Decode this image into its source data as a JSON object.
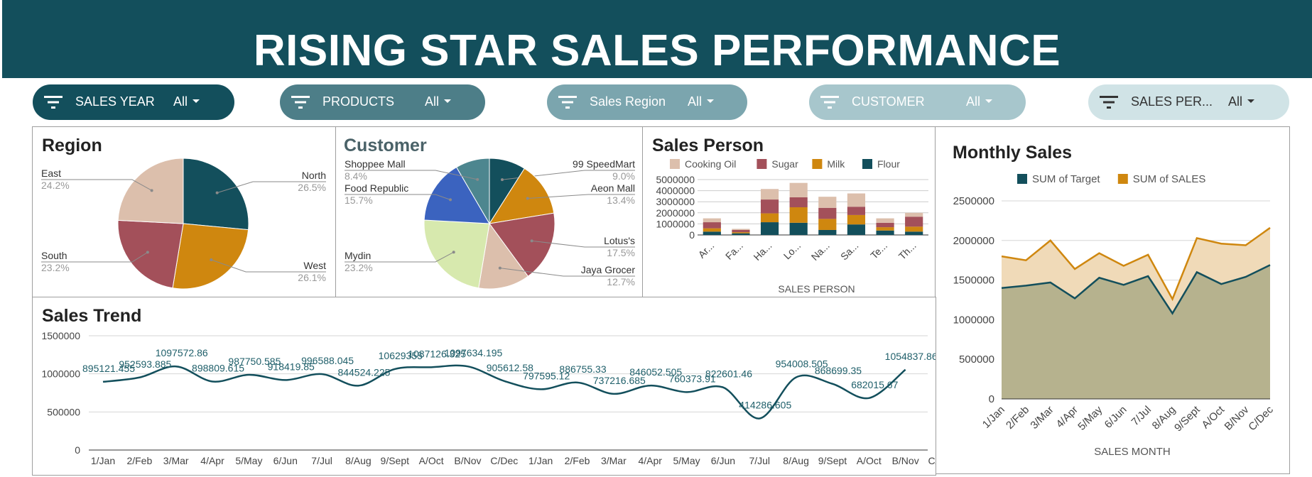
{
  "header": {
    "title": "RISING STAR SALES PERFORMANCE"
  },
  "filters": [
    {
      "label": "SALES YEAR",
      "value": "All",
      "bg": "#134f5c",
      "fg": "#ffffff"
    },
    {
      "label": "PRODUCTS",
      "value": "All",
      "bg": "#4d7e88",
      "fg": "#ffffff"
    },
    {
      "label": "Sales Region",
      "value": "All",
      "bg": "#7ba5ae",
      "fg": "#ffffff"
    },
    {
      "label": "CUSTOMER",
      "value": "All",
      "bg": "#a7c6cc",
      "fg": "#ffffff"
    },
    {
      "label": "SALES PER...",
      "value": "All",
      "bg": "#d0e3e6",
      "fg": "#333333"
    }
  ],
  "chart_data": [
    {
      "type": "pie",
      "title": "Region",
      "slices": [
        {
          "label": "North",
          "value": 26.5,
          "pct": "26.5%",
          "color": "#134f5c"
        },
        {
          "label": "West",
          "value": 26.1,
          "pct": "26.1%",
          "color": "#cf870f"
        },
        {
          "label": "South",
          "value": 23.2,
          "pct": "23.2%",
          "color": "#a3505a"
        },
        {
          "label": "East",
          "value": 24.2,
          "pct": "24.2%",
          "color": "#dcbfac"
        }
      ]
    },
    {
      "type": "pie",
      "title": "Customer",
      "slices": [
        {
          "label": "99 SpeedMart",
          "value": 9.0,
          "pct": "9.0%",
          "color": "#134f5c"
        },
        {
          "label": "Aeon Mall",
          "value": 13.4,
          "pct": "13.4%",
          "color": "#cf870f"
        },
        {
          "label": "Lotus's",
          "value": 17.5,
          "pct": "17.5%",
          "color": "#a3505a"
        },
        {
          "label": "Jaya Grocer",
          "value": 12.7,
          "pct": "12.7%",
          "color": "#dcbfac"
        },
        {
          "label": "Mydin",
          "value": 23.2,
          "pct": "23.2%",
          "color": "#d7e9ae"
        },
        {
          "label": "Food Republic",
          "value": 15.7,
          "pct": "15.7%",
          "color": "#3b63bf"
        },
        {
          "label": "Shoppee Mall",
          "value": 8.4,
          "pct": "8.4%",
          "color": "#4d868f"
        }
      ]
    },
    {
      "type": "bar",
      "stacked": true,
      "title": "Sales Person",
      "xlabel": "SALES PERSON",
      "categories": [
        "Ar...",
        "Fa...",
        "Ha...",
        "Lo...",
        "Na...",
        "Sa...",
        "Te...",
        "Th..."
      ],
      "ylim": [
        0,
        5000000
      ],
      "yticks": [
        "5000000",
        "4000000",
        "3000000",
        "2000000",
        "1000000",
        "0"
      ],
      "legend_position": "top",
      "series": [
        {
          "name": "Flour",
          "color": "#134f5c",
          "values": [
            300000,
            150000,
            1150000,
            1100000,
            450000,
            950000,
            400000,
            300000
          ]
        },
        {
          "name": "Milk",
          "color": "#cf870f",
          "values": [
            300000,
            100000,
            800000,
            1400000,
            1000000,
            850000,
            300000,
            450000
          ]
        },
        {
          "name": "Sugar",
          "color": "#a3505a",
          "values": [
            550000,
            200000,
            1250000,
            900000,
            1000000,
            750000,
            400000,
            900000
          ]
        },
        {
          "name": "Cooking Oil",
          "color": "#dcbfac",
          "values": [
            350000,
            100000,
            950000,
            1300000,
            1000000,
            1200000,
            400000,
            350000
          ]
        }
      ]
    },
    {
      "type": "area",
      "title": "Monthly Sales",
      "xlabel": "SALES MONTH",
      "categories": [
        "1/Jan",
        "2/Feb",
        "3/Mar",
        "4/Apr",
        "5/May",
        "6/Jun",
        "7/Jul",
        "8/Aug",
        "9/Sept",
        "A/Oct",
        "B/Nov",
        "C/Dec"
      ],
      "ylim": [
        0,
        2500000
      ],
      "yticks": [
        "2500000",
        "2000000",
        "1500000",
        "1000000",
        "500000",
        "0"
      ],
      "legend_position": "top",
      "series": [
        {
          "name": "SUM of Target",
          "color": "#134f5c",
          "fill": "#b6b28e",
          "values": [
            1400000,
            1430000,
            1470000,
            1270000,
            1530000,
            1440000,
            1550000,
            1080000,
            1600000,
            1450000,
            1540000,
            1690000
          ]
        },
        {
          "name": "SUM of SALES",
          "color": "#cf870f",
          "fill": "#f0dab8",
          "values": [
            1800000,
            1750000,
            2000000,
            1640000,
            1840000,
            1680000,
            1820000,
            1260000,
            2030000,
            1960000,
            1940000,
            2160000
          ]
        }
      ]
    },
    {
      "type": "line",
      "title": "Sales Trend",
      "categories": [
        "1/Jan",
        "2/Feb",
        "3/Mar",
        "4/Apr",
        "5/May",
        "6/Jun",
        "7/Jul",
        "8/Aug",
        "9/Sept",
        "A/Oct",
        "B/Nov",
        "C/Dec",
        "1/Jan",
        "2/Feb",
        "3/Mar",
        "4/Apr",
        "5/May",
        "6/Jun",
        "7/Jul",
        "8/Aug",
        "9/Sept",
        "A/Oct",
        "B/Nov",
        "C/Dec"
      ],
      "ylim": [
        0,
        1500000
      ],
      "yticks": [
        "1500000",
        "1000000",
        "500000",
        "0"
      ],
      "series": [
        {
          "name": "",
          "color": "#134f5c",
          "values": [
            895121.455,
            952593.885,
            1097572.86,
            898809.615,
            987750.585,
            918419.85,
            996588.045,
            844524.225,
            1062935,
            1087126.325,
            1097634.195,
            905612.58,
            797595.12,
            886755.33,
            737216.685,
            846052.505,
            760373.91,
            822601.46,
            414286.605,
            954008.505,
            868699.35,
            682015.67,
            1054837.86
          ],
          "point_x": [
            0,
            1,
            2,
            3,
            4,
            5,
            6,
            7,
            8,
            9,
            10,
            11,
            12,
            13,
            14,
            15,
            16,
            17,
            18,
            19,
            20,
            21,
            22
          ],
          "labels": [
            "895121.455",
            "952593.885",
            "1097572.86",
            "898809.615",
            "987750.585",
            "918419.85",
            "996588.045",
            "844524.225",
            "10629355",
            "1087126.325",
            "1097634.195",
            "905612.58",
            "797595.12",
            "886755.33",
            "737216.685",
            "846052.505",
            "760373.91",
            "822601.46",
            "414286.605",
            "954008.505",
            "868699.35",
            "682015.67",
            "1054837.86"
          ]
        }
      ]
    }
  ]
}
